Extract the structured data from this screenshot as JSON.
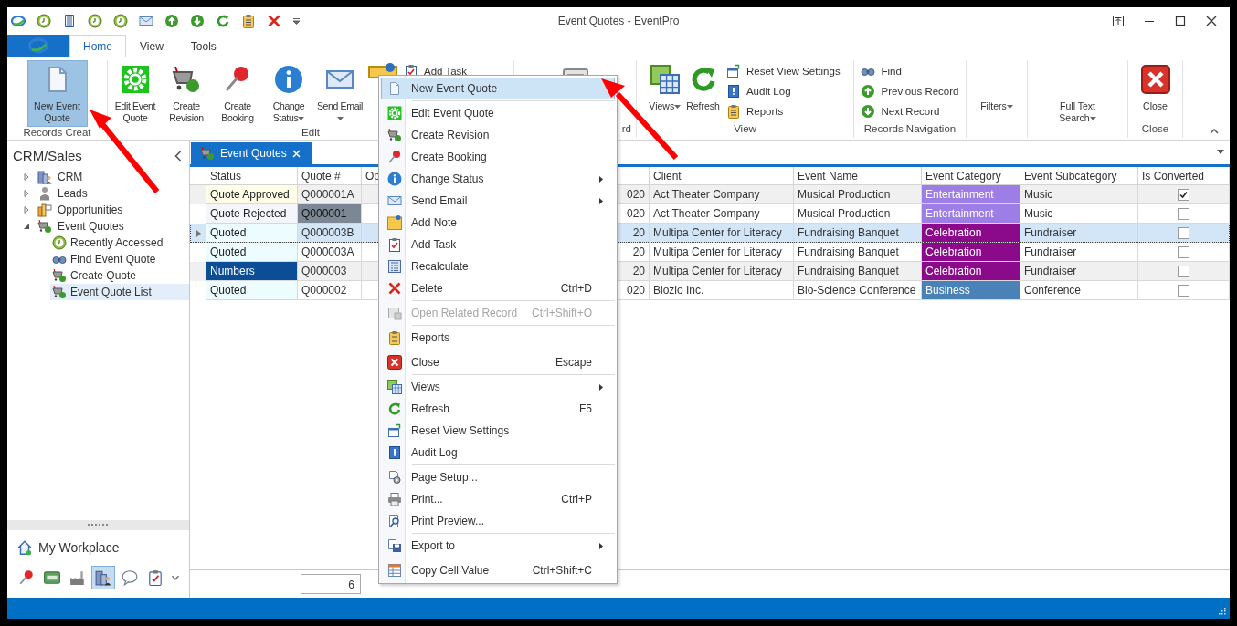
{
  "window": {
    "title": "Event Quotes - EventPro"
  },
  "ribbon": {
    "tabs": [
      {
        "label": "Home",
        "selected": true
      },
      {
        "label": "View",
        "selected": false
      },
      {
        "label": "Tools",
        "selected": false
      }
    ],
    "groups": [
      {
        "label": "Records Creat",
        "items": [
          {
            "kind": "large",
            "label": "New Event Quote",
            "selected": true,
            "dropdown": false
          }
        ]
      },
      {
        "label": "Edit",
        "items": [
          {
            "kind": "large",
            "label": "Edit Event Quote",
            "selected": false,
            "dropdown": false
          },
          {
            "kind": "large",
            "label": "Create Revision",
            "selected": false,
            "dropdown": false
          },
          {
            "kind": "large",
            "label": "Create Booking",
            "selected": false,
            "dropdown": false
          },
          {
            "kind": "large",
            "label": "Change Status",
            "selected": false,
            "dropdown": true
          },
          {
            "kind": "large",
            "label": "Send Email",
            "selected": false,
            "dropdown": true
          },
          {
            "kind": "icon",
            "selected": false
          },
          {
            "kind": "small",
            "label": "Add Task",
            "selected": false
          }
        ]
      },
      {
        "label": "rd",
        "items": [
          {
            "kind": "icon",
            "selected": false
          }
        ]
      },
      {
        "label": "View",
        "items": [
          {
            "kind": "large",
            "label": "Views",
            "selected": false,
            "dropdown": true
          },
          {
            "kind": "large",
            "label": "Refresh",
            "selected": false,
            "dropdown": false
          },
          {
            "kind": "small",
            "label": "Reset View Settings",
            "selected": false
          },
          {
            "kind": "small",
            "label": "Audit Log",
            "selected": false
          },
          {
            "kind": "small",
            "label": "Reports",
            "selected": false
          }
        ]
      },
      {
        "label": "Records Navigation",
        "items": [
          {
            "kind": "small",
            "label": "Find",
            "selected": false
          },
          {
            "kind": "small",
            "label": "Previous Record",
            "selected": false
          },
          {
            "kind": "small",
            "label": "Next Record",
            "selected": false
          }
        ]
      },
      {
        "items": [
          {
            "kind": "large",
            "label": "Filters",
            "selected": false,
            "dropdown": true
          }
        ]
      },
      {
        "items": [
          {
            "kind": "large",
            "label": "Full Text Search",
            "selected": false,
            "dropdown": true
          }
        ]
      },
      {
        "label": "Close",
        "items": [
          {
            "kind": "large",
            "label": "Close",
            "selected": false,
            "dropdown": false
          }
        ]
      }
    ]
  },
  "sidebar": {
    "title": "CRM/Sales",
    "tree": [
      {
        "label": "CRM",
        "expanded": false,
        "selected": false
      },
      {
        "label": "Leads",
        "expanded": false,
        "selected": false
      },
      {
        "label": "Opportunities",
        "expanded": false,
        "selected": false
      },
      {
        "label": "Event Quotes",
        "expanded": true,
        "selected": false,
        "children": [
          {
            "label": "Recently Accessed",
            "selected": false
          },
          {
            "label": "Find Event Quote",
            "selected": false
          },
          {
            "label": "Create Quote",
            "selected": false
          },
          {
            "label": "Event Quote List",
            "selected": true
          }
        ]
      }
    ],
    "workplace": "My Workplace",
    "nav_buttons": [
      {
        "selected": false
      },
      {
        "selected": false
      },
      {
        "selected": false
      },
      {
        "selected": true
      },
      {
        "selected": false
      },
      {
        "selected": false
      }
    ]
  },
  "document_tabs": [
    {
      "label": "Event Quotes",
      "selected": true
    }
  ],
  "table": {
    "columns": [
      "Status",
      "Quote #",
      "Op",
      "",
      "Client",
      "Event Name",
      "Event Category",
      "Event Subcategory",
      "Is Converted"
    ],
    "rows": [
      {
        "selected": false,
        "status": {
          "text": "Quote Approved",
          "color": "#fffde8"
        },
        "quote": "Q000001A",
        "quote_highlighted": false,
        "column_4": "020",
        "client": "Act Theater Company",
        "event_name": "Musical Production",
        "event_category": {
          "text": "Entertainment",
          "color": "#9c7ee6"
        },
        "event_subcategory": "Music",
        "is_converted": true
      },
      {
        "selected": false,
        "status": {
          "text": "Quote Rejected",
          "color": "#f4f6fb"
        },
        "quote": "Q000001",
        "quote_highlighted": true,
        "column_4": "020",
        "client": "Act Theater Company",
        "event_name": "Musical Production",
        "event_category": {
          "text": "Entertainment",
          "color": "#9c7ee6"
        },
        "event_subcategory": "Music",
        "is_converted": false
      },
      {
        "selected": true,
        "status": {
          "text": "Quoted",
          "color": "#ecfcff"
        },
        "quote": "Q000003B",
        "quote_highlighted": false,
        "column_4": "20",
        "client": "Multipa Center for Literacy",
        "event_name": "Fundraising Banquet",
        "event_category": {
          "text": "Celebration",
          "color": "#8b0a8b"
        },
        "event_subcategory": "Fundraiser",
        "is_converted": false
      },
      {
        "selected": false,
        "status": {
          "text": "Quoted",
          "color": "#ecfcff"
        },
        "quote": "Q000003A",
        "quote_highlighted": false,
        "column_4": "20",
        "client": "Multipa Center for Literacy",
        "event_name": "Fundraising Banquet",
        "event_category": {
          "text": "Celebration",
          "color": "#8b0a8b"
        },
        "event_subcategory": "Fundraiser",
        "is_converted": false
      },
      {
        "selected": false,
        "status": {
          "text": "Numbers",
          "color": "#0b4d96"
        },
        "quote": "Q000003",
        "quote_highlighted": false,
        "column_4": "20",
        "client": "Multipa Center for Literacy",
        "event_name": "Fundraising Banquet",
        "event_category": {
          "text": "Celebration",
          "color": "#8b0a8b"
        },
        "event_subcategory": "Fundraiser",
        "is_converted": false
      },
      {
        "selected": false,
        "status": {
          "text": "Quoted",
          "color": "#ecfcff"
        },
        "quote": "Q000002",
        "quote_highlighted": false,
        "column_4": "020",
        "client": "Biozio Inc.",
        "event_name": "Bio-Science Conference",
        "event_category": {
          "text": "Business",
          "color": "#4a82b8"
        },
        "event_subcategory": "Conference",
        "is_converted": false
      }
    ],
    "row_count": "6"
  },
  "context_menu": {
    "items": [
      {
        "kind": "item",
        "label": "New Event Quote",
        "selected": true,
        "disabled": false,
        "submenu": false
      },
      {
        "kind": "separator"
      },
      {
        "kind": "item",
        "label": "Edit Event Quote",
        "selected": false,
        "disabled": false,
        "submenu": false
      },
      {
        "kind": "item",
        "label": "Create Revision",
        "selected": false,
        "disabled": false,
        "submenu": false
      },
      {
        "kind": "item",
        "label": "Create Booking",
        "selected": false,
        "disabled": false,
        "submenu": false
      },
      {
        "kind": "item",
        "label": "Change Status",
        "selected": false,
        "disabled": false,
        "submenu": true
      },
      {
        "kind": "item",
        "label": "Send Email",
        "selected": false,
        "disabled": false,
        "submenu": true
      },
      {
        "kind": "item",
        "label": "Add Note",
        "selected": false,
        "disabled": false,
        "submenu": false
      },
      {
        "kind": "item",
        "label": "Add Task",
        "selected": false,
        "disabled": false,
        "submenu": false
      },
      {
        "kind": "item",
        "label": "Recalculate",
        "selected": false,
        "disabled": false,
        "submenu": false
      },
      {
        "kind": "item",
        "label": "Delete",
        "shortcut": "Ctrl+D",
        "selected": false,
        "disabled": false,
        "submenu": false
      },
      {
        "kind": "separator"
      },
      {
        "kind": "item",
        "label": "Open Related Record",
        "shortcut": "Ctrl+Shift+O",
        "selected": false,
        "disabled": true,
        "submenu": false
      },
      {
        "kind": "separator"
      },
      {
        "kind": "item",
        "label": "Reports",
        "selected": false,
        "disabled": false,
        "submenu": false
      },
      {
        "kind": "separator"
      },
      {
        "kind": "item",
        "label": "Close",
        "shortcut": "Escape",
        "selected": false,
        "disabled": false,
        "submenu": false
      },
      {
        "kind": "separator"
      },
      {
        "kind": "item",
        "label": "Views",
        "selected": false,
        "disabled": false,
        "submenu": true
      },
      {
        "kind": "item",
        "label": "Refresh",
        "shortcut": "F5",
        "selected": false,
        "disabled": false,
        "submenu": false
      },
      {
        "kind": "item",
        "label": "Reset View Settings",
        "selected": false,
        "disabled": false,
        "submenu": false
      },
      {
        "kind": "item",
        "label": "Audit Log",
        "selected": false,
        "disabled": false,
        "submenu": false
      },
      {
        "kind": "separator"
      },
      {
        "kind": "item",
        "label": "Page Setup...",
        "selected": false,
        "disabled": false,
        "submenu": false
      },
      {
        "kind": "item",
        "label": "Print...",
        "shortcut": "Ctrl+P",
        "selected": false,
        "disabled": false,
        "submenu": false
      },
      {
        "kind": "item",
        "label": "Print Preview...",
        "selected": false,
        "disabled": false,
        "submenu": false
      },
      {
        "kind": "separator"
      },
      {
        "kind": "item",
        "label": "Export to",
        "selected": false,
        "disabled": false,
        "submenu": true
      },
      {
        "kind": "separator"
      },
      {
        "kind": "item",
        "label": "Copy Cell Value",
        "shortcut": "Ctrl+Shift+C",
        "selected": false,
        "disabled": false,
        "submenu": false
      }
    ]
  }
}
